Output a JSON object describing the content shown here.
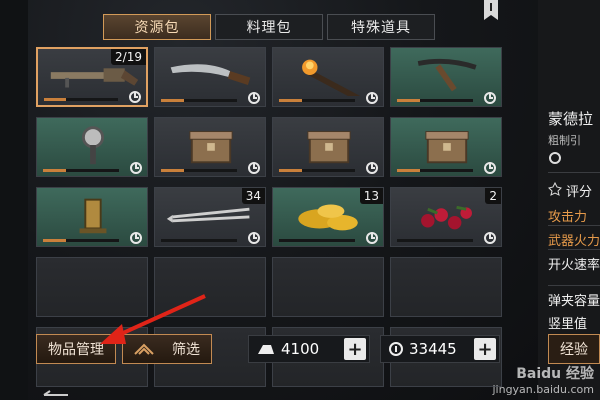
{
  "tabs": [
    {
      "label": "资源包",
      "active": true
    },
    {
      "label": "料理包",
      "active": false
    },
    {
      "label": "特殊道具",
      "active": false
    }
  ],
  "slots": [
    {
      "type": "gray",
      "item": "rifle-icon",
      "count": "2/19",
      "selected": true,
      "progress": 0.3
    },
    {
      "type": "gray",
      "item": "machete-icon",
      "count": "",
      "progress": 0.3
    },
    {
      "type": "gray",
      "item": "torch-icon",
      "count": "",
      "progress": 0.3
    },
    {
      "type": "green",
      "item": "pickaxe-icon",
      "count": "",
      "progress": 0.3
    },
    {
      "type": "green",
      "item": "shield-club-icon",
      "count": "",
      "progress": 0.3
    },
    {
      "type": "gray",
      "item": "chest-icon",
      "count": "",
      "progress": 0.3
    },
    {
      "type": "gray",
      "item": "chest-icon",
      "count": "",
      "progress": 0.3
    },
    {
      "type": "green",
      "item": "chest-icon",
      "count": "",
      "progress": 0.3
    },
    {
      "type": "green",
      "item": "lantern-icon",
      "count": "",
      "progress": 0.3
    },
    {
      "type": "gray",
      "item": "arrows-icon",
      "count": "34",
      "progress": 0
    },
    {
      "type": "green",
      "item": "mushroom-icon",
      "count": "13",
      "progress": 0
    },
    {
      "type": "gray",
      "item": "berries-icon",
      "count": "2",
      "progress": 0
    },
    {
      "type": "empty"
    },
    {
      "type": "empty"
    },
    {
      "type": "empty"
    },
    {
      "type": "empty"
    },
    {
      "type": "empty"
    },
    {
      "type": "empty"
    },
    {
      "type": "empty"
    },
    {
      "type": "empty"
    }
  ],
  "buttons": {
    "manage": "物品管理",
    "filter": "筛选"
  },
  "resources": {
    "iron": "4100",
    "gold": "33445"
  },
  "right_panel": {
    "name": "蒙德拉",
    "sub": "粗制引",
    "rating": "评分",
    "stats": [
      "攻击力",
      "武器火力",
      "开火速率",
      "弹夹容量",
      "竖里值"
    ],
    "action": "经验"
  },
  "watermark": {
    "line1": "Baidu 经验",
    "line2": "jingyan.baidu.com"
  },
  "colors": {
    "accent": "#d29a58",
    "progress": "#c9803b",
    "stat_orange": "#e69a4a",
    "arrow": "#e02418"
  }
}
